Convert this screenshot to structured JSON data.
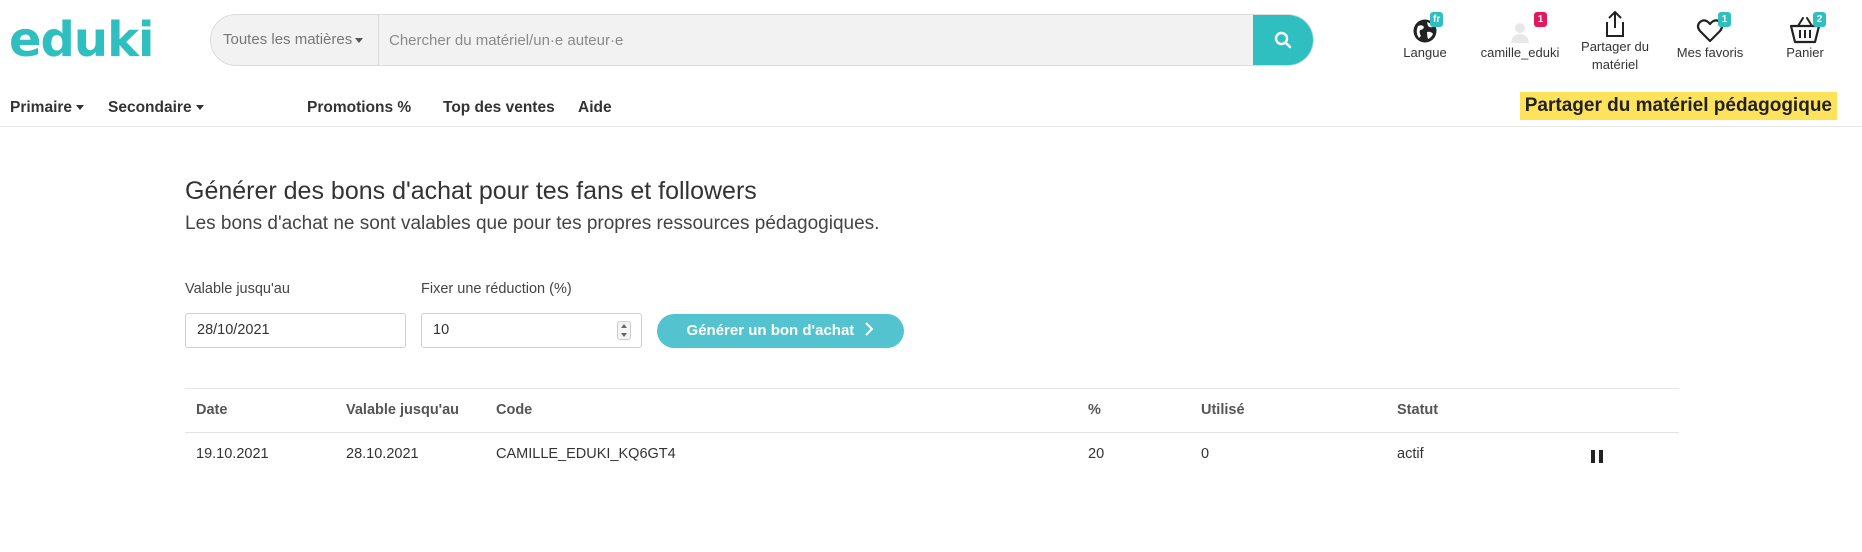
{
  "header": {
    "logo": "eduki",
    "search": {
      "subject_label": "Toutes les matières",
      "placeholder": "Chercher du matériel/un·e auteur·e"
    },
    "icons": {
      "language": {
        "label": "Langue",
        "badge": "fr"
      },
      "account": {
        "label": "camille_eduki",
        "badge": "1"
      },
      "share": {
        "label_line1": "Partager du",
        "label_line2": "matériel"
      },
      "favorites": {
        "label": "Mes favoris",
        "badge": "1"
      },
      "cart": {
        "label": "Panier",
        "badge": "2"
      }
    }
  },
  "nav": {
    "primaire": "Primaire",
    "secondaire": "Secondaire",
    "promotions": "Promotions %",
    "top": "Top des ventes",
    "aide": "Aide",
    "share_highlight": "Partager du matériel pédagogique"
  },
  "main": {
    "title": "Générer des bons d'achat pour tes fans et followers",
    "subtitle": "Les bons d'achat ne sont valables que pour tes propres ressources pédagogiques.",
    "form": {
      "valid_until_label": "Valable jusqu'au",
      "valid_until_value": "28/10/2021",
      "discount_label": "Fixer une réduction (%)",
      "discount_value": "10",
      "generate_label": "Générer un bon d'achat"
    },
    "table": {
      "headers": {
        "date": "Date",
        "valid": "Valable jusqu'au",
        "code": "Code",
        "pct": "%",
        "used": "Utilisé",
        "status": "Statut"
      },
      "rows": [
        {
          "date": "19.10.2021",
          "valid": "28.10.2021",
          "code": "CAMILLE_EDUKI_KQ6GT4",
          "pct": "20",
          "used": "0",
          "status": "actif"
        }
      ]
    }
  },
  "colors": {
    "brand": "#2fbfc1",
    "highlight": "#fde25b",
    "badge_red": "#e5175f",
    "button": "#52c3cf"
  }
}
